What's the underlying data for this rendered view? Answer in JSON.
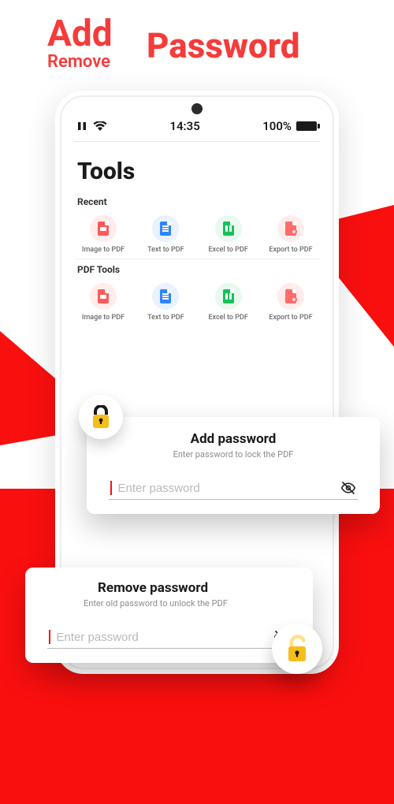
{
  "hero": {
    "add": "Add",
    "password": "Password",
    "remove": "Remove"
  },
  "statusbar": {
    "time": "14:35",
    "battery_text": "100%"
  },
  "page_title": "Tools",
  "sections": {
    "recent": {
      "title": "Recent",
      "tools": [
        {
          "label": "Image to PDF"
        },
        {
          "label": "Text to PDF"
        },
        {
          "label": "Excel to PDF"
        },
        {
          "label": "Export to PDF"
        }
      ]
    },
    "pdf_tools": {
      "title": "PDF Tools",
      "tools": [
        {
          "label": "Image to PDF"
        },
        {
          "label": "Text to PDF"
        },
        {
          "label": "Excel to PDF"
        },
        {
          "label": "Export to PDF"
        }
      ]
    }
  },
  "add_card": {
    "title": "Add password",
    "subtitle": "Enter password to lock the PDF",
    "placeholder": "Enter password"
  },
  "remove_card": {
    "title": "Remove password",
    "subtitle": "Enter old password to unlock the PDF",
    "placeholder": "Enter password"
  }
}
